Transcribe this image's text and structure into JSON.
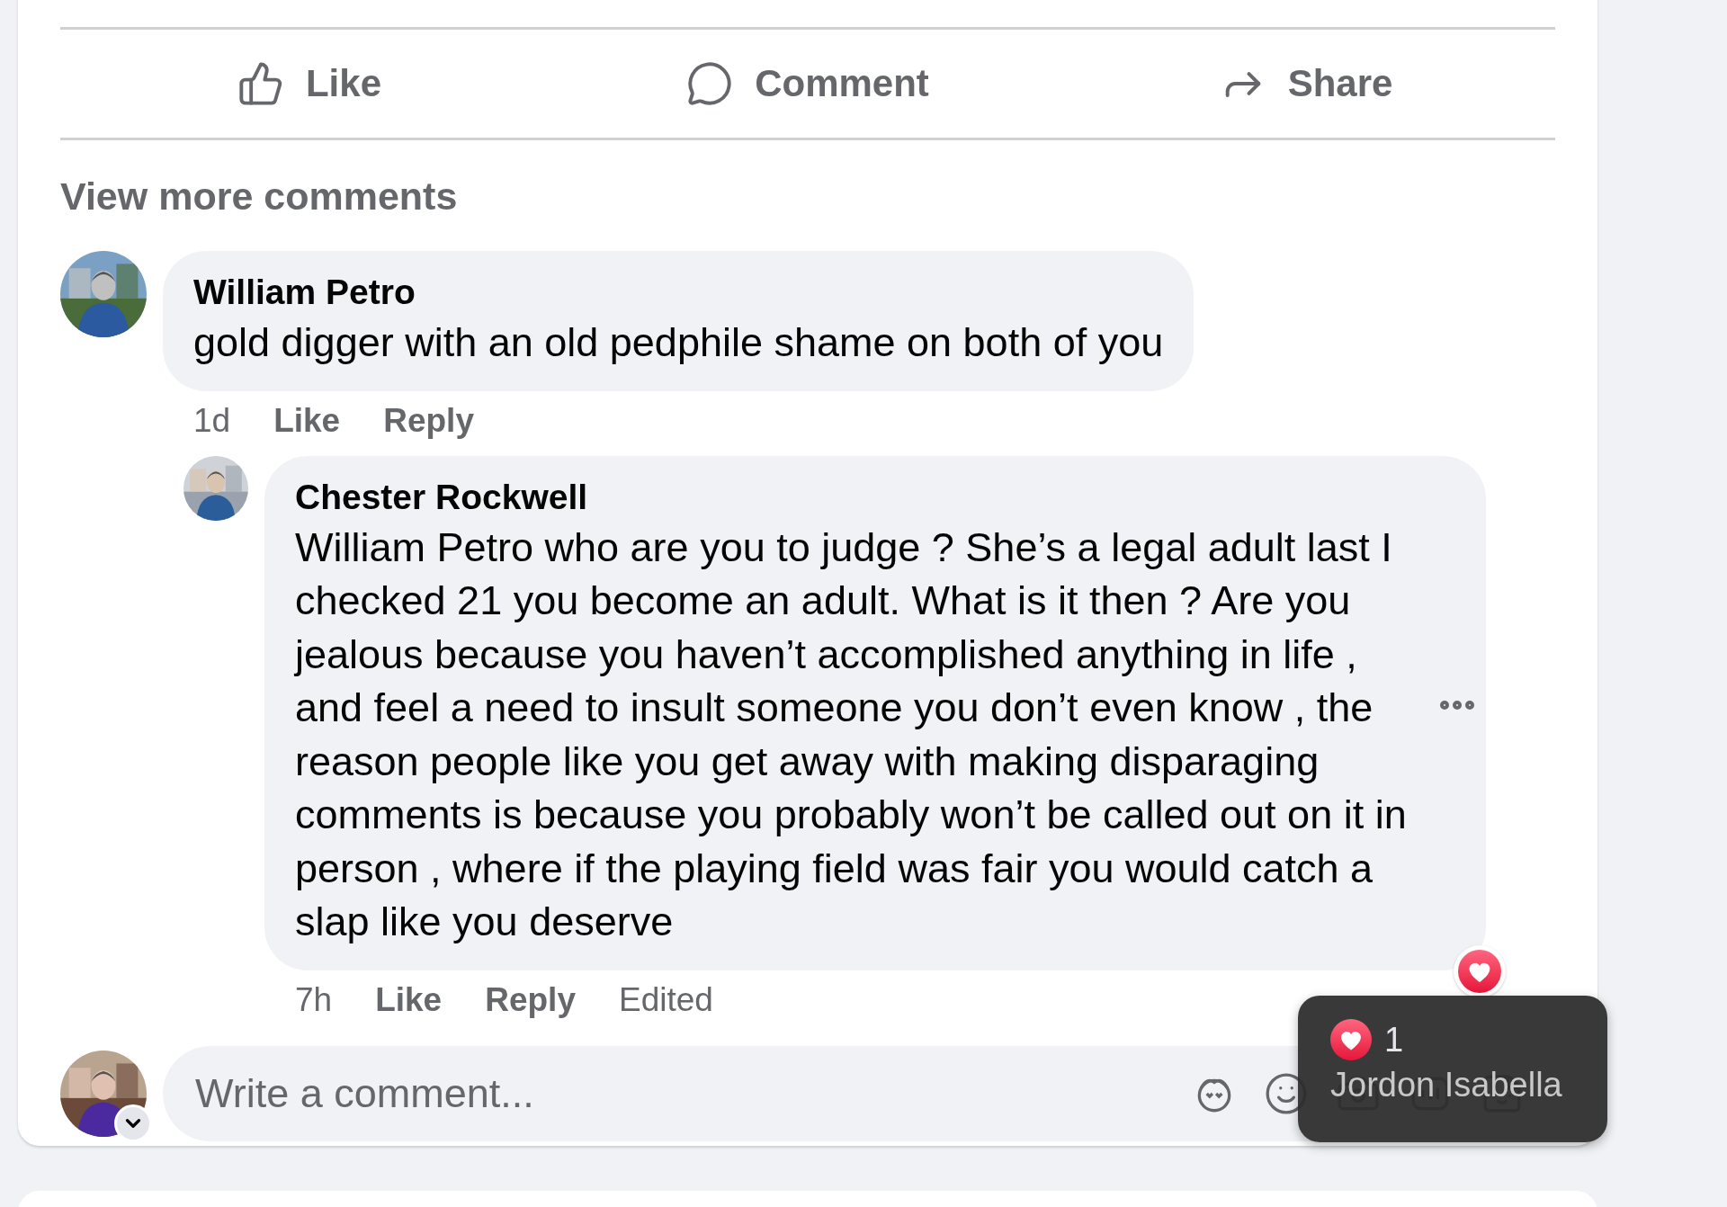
{
  "actions": [
    {
      "kind": "like",
      "label": "Like"
    },
    {
      "kind": "comment",
      "label": "Comment"
    },
    {
      "kind": "share",
      "label": "Share"
    }
  ],
  "view_more": "View more comments",
  "comments": [
    {
      "author": "William Petro",
      "text": "gold digger with an old pedphile shame on both of you",
      "time": "1d",
      "like": "Like",
      "reply": "Reply",
      "reply_level": false,
      "loved": false,
      "has_menu": false
    },
    {
      "author": "Chester Rockwell",
      "text": "William Petro who are you to judge ? She’s a legal adult last I checked 21 you become an adult. What is it then ? Are you jealous because you haven’t accomplished anything in life , and feel a need to insult someone you don’t even know , the reason people like you get away with making disparaging comments is because you probably won’t be called out on it in person , where if the playing field was fair you would catch a slap like you deserve",
      "time": "7h",
      "like": "Like",
      "reply": "Reply",
      "reply_level": true,
      "edited": "Edited",
      "loved": true,
      "has_menu": true
    }
  ],
  "composer": {
    "placeholder": "Write a comment..."
  },
  "tooltip": {
    "count": "1",
    "name": "Jordon Isabella"
  }
}
